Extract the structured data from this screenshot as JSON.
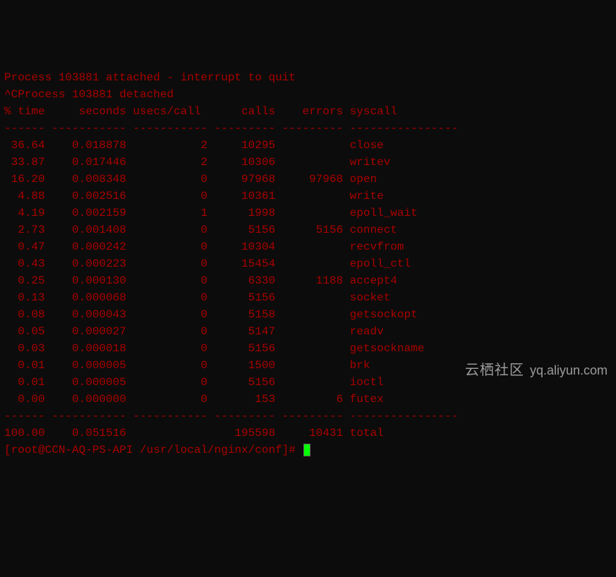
{
  "header": {
    "attached": "Process 103881 attached - interrupt to quit",
    "detached": "^CProcess 103881 detached"
  },
  "columns": {
    "pct_time": "% time",
    "seconds": "seconds",
    "usecs_call": "usecs/call",
    "calls": "calls",
    "errors": "errors",
    "syscall": "syscall"
  },
  "separator": "------ ----------- ----------- --------- --------- ----------------",
  "rows": [
    {
      "pct": "36.64",
      "sec": "0.018878",
      "usec": "2",
      "calls": "10295",
      "err": "",
      "sys": "close"
    },
    {
      "pct": "33.87",
      "sec": "0.017446",
      "usec": "2",
      "calls": "10306",
      "err": "",
      "sys": "writev"
    },
    {
      "pct": "16.20",
      "sec": "0.008348",
      "usec": "0",
      "calls": "97968",
      "err": "97968",
      "sys": "open"
    },
    {
      "pct": "4.88",
      "sec": "0.002516",
      "usec": "0",
      "calls": "10361",
      "err": "",
      "sys": "write"
    },
    {
      "pct": "4.19",
      "sec": "0.002159",
      "usec": "1",
      "calls": "1998",
      "err": "",
      "sys": "epoll_wait"
    },
    {
      "pct": "2.73",
      "sec": "0.001408",
      "usec": "0",
      "calls": "5156",
      "err": "5156",
      "sys": "connect"
    },
    {
      "pct": "0.47",
      "sec": "0.000242",
      "usec": "0",
      "calls": "10304",
      "err": "",
      "sys": "recvfrom"
    },
    {
      "pct": "0.43",
      "sec": "0.000223",
      "usec": "0",
      "calls": "15454",
      "err": "",
      "sys": "epoll_ctl"
    },
    {
      "pct": "0.25",
      "sec": "0.000130",
      "usec": "0",
      "calls": "6330",
      "err": "1188",
      "sys": "accept4"
    },
    {
      "pct": "0.13",
      "sec": "0.000068",
      "usec": "0",
      "calls": "5156",
      "err": "",
      "sys": "socket"
    },
    {
      "pct": "0.08",
      "sec": "0.000043",
      "usec": "0",
      "calls": "5158",
      "err": "",
      "sys": "getsockopt"
    },
    {
      "pct": "0.05",
      "sec": "0.000027",
      "usec": "0",
      "calls": "5147",
      "err": "",
      "sys": "readv"
    },
    {
      "pct": "0.03",
      "sec": "0.000018",
      "usec": "0",
      "calls": "5156",
      "err": "",
      "sys": "getsockname"
    },
    {
      "pct": "0.01",
      "sec": "0.000005",
      "usec": "0",
      "calls": "1500",
      "err": "",
      "sys": "brk"
    },
    {
      "pct": "0.01",
      "sec": "0.000005",
      "usec": "0",
      "calls": "5156",
      "err": "",
      "sys": "ioctl"
    },
    {
      "pct": "0.00",
      "sec": "0.000000",
      "usec": "0",
      "calls": "153",
      "err": "6",
      "sys": "futex"
    }
  ],
  "totals": {
    "pct": "100.00",
    "sec": "0.051516",
    "usec": "",
    "calls": "195598",
    "err": "10431",
    "sys": "total"
  },
  "prompt": "[root@CCN-AQ-PS-API /usr/local/nginx/conf]#",
  "watermark": {
    "logo_text": "云栖社区",
    "url": "yq.aliyun.com"
  }
}
